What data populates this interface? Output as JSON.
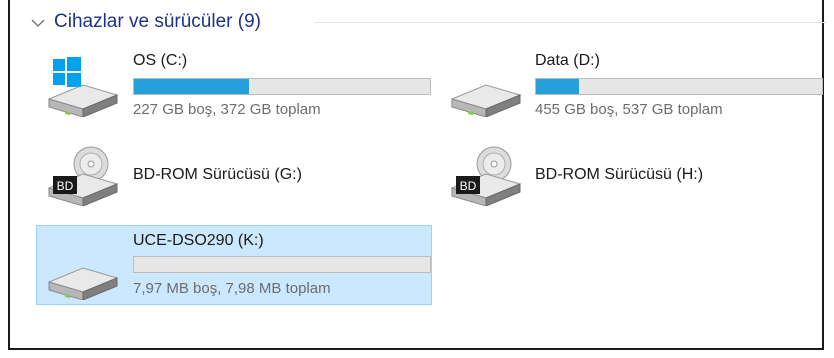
{
  "group": {
    "title": "Cihazlar ve sürücüler (9)"
  },
  "drives": [
    {
      "name": "OS (C:)",
      "info": "227 GB boş, 372 GB toplam",
      "used_fraction": 0.39,
      "icon": "windows-hard-drive-icon"
    },
    {
      "name": "Data (D:)",
      "info": "455 GB boş, 537 GB toplam",
      "used_fraction": 0.15,
      "icon": "hard-drive-icon"
    },
    {
      "name": "BD-ROM Sürücüsü (G:)",
      "icon": "bd-rom-drive-icon",
      "badge": "BD"
    },
    {
      "name": "BD-ROM Sürücüsü (H:)",
      "icon": "bd-rom-drive-icon",
      "badge": "BD"
    },
    {
      "name": "UCE-DSO290 (K:)",
      "info": "7,97 MB boş, 7,98 MB toplam",
      "used_fraction": 0.0,
      "icon": "hard-drive-icon",
      "selected": true
    }
  ],
  "colors": {
    "header_text": "#1e3287",
    "bar_fill": "#26a0da",
    "selection_bg": "#cce8ff",
    "windows_logo": "#00a2ed"
  }
}
